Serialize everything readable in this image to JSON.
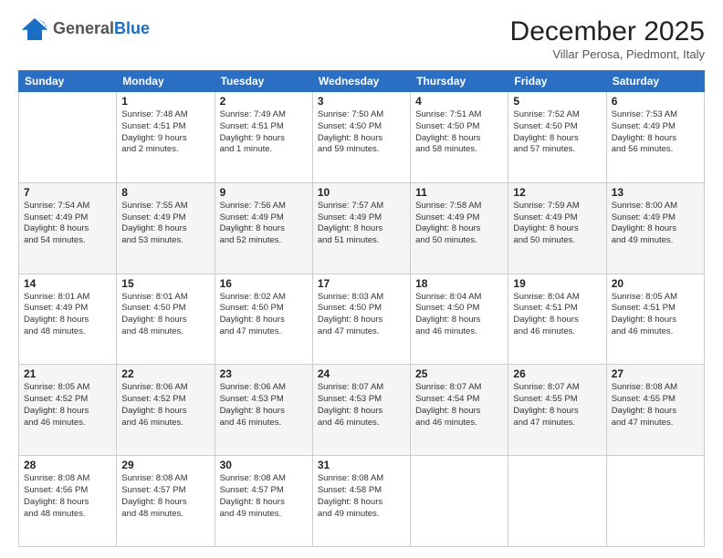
{
  "logo": {
    "general": "General",
    "blue": "Blue"
  },
  "header": {
    "month": "December 2025",
    "location": "Villar Perosa, Piedmont, Italy"
  },
  "days_of_week": [
    "Sunday",
    "Monday",
    "Tuesday",
    "Wednesday",
    "Thursday",
    "Friday",
    "Saturday"
  ],
  "weeks": [
    [
      {
        "day": "",
        "info": ""
      },
      {
        "day": "1",
        "info": "Sunrise: 7:48 AM\nSunset: 4:51 PM\nDaylight: 9 hours\nand 2 minutes."
      },
      {
        "day": "2",
        "info": "Sunrise: 7:49 AM\nSunset: 4:51 PM\nDaylight: 9 hours\nand 1 minute."
      },
      {
        "day": "3",
        "info": "Sunrise: 7:50 AM\nSunset: 4:50 PM\nDaylight: 8 hours\nand 59 minutes."
      },
      {
        "day": "4",
        "info": "Sunrise: 7:51 AM\nSunset: 4:50 PM\nDaylight: 8 hours\nand 58 minutes."
      },
      {
        "day": "5",
        "info": "Sunrise: 7:52 AM\nSunset: 4:50 PM\nDaylight: 8 hours\nand 57 minutes."
      },
      {
        "day": "6",
        "info": "Sunrise: 7:53 AM\nSunset: 4:49 PM\nDaylight: 8 hours\nand 56 minutes."
      }
    ],
    [
      {
        "day": "7",
        "info": "Sunrise: 7:54 AM\nSunset: 4:49 PM\nDaylight: 8 hours\nand 54 minutes."
      },
      {
        "day": "8",
        "info": "Sunrise: 7:55 AM\nSunset: 4:49 PM\nDaylight: 8 hours\nand 53 minutes."
      },
      {
        "day": "9",
        "info": "Sunrise: 7:56 AM\nSunset: 4:49 PM\nDaylight: 8 hours\nand 52 minutes."
      },
      {
        "day": "10",
        "info": "Sunrise: 7:57 AM\nSunset: 4:49 PM\nDaylight: 8 hours\nand 51 minutes."
      },
      {
        "day": "11",
        "info": "Sunrise: 7:58 AM\nSunset: 4:49 PM\nDaylight: 8 hours\nand 50 minutes."
      },
      {
        "day": "12",
        "info": "Sunrise: 7:59 AM\nSunset: 4:49 PM\nDaylight: 8 hours\nand 50 minutes."
      },
      {
        "day": "13",
        "info": "Sunrise: 8:00 AM\nSunset: 4:49 PM\nDaylight: 8 hours\nand 49 minutes."
      }
    ],
    [
      {
        "day": "14",
        "info": "Sunrise: 8:01 AM\nSunset: 4:49 PM\nDaylight: 8 hours\nand 48 minutes."
      },
      {
        "day": "15",
        "info": "Sunrise: 8:01 AM\nSunset: 4:50 PM\nDaylight: 8 hours\nand 48 minutes."
      },
      {
        "day": "16",
        "info": "Sunrise: 8:02 AM\nSunset: 4:50 PM\nDaylight: 8 hours\nand 47 minutes."
      },
      {
        "day": "17",
        "info": "Sunrise: 8:03 AM\nSunset: 4:50 PM\nDaylight: 8 hours\nand 47 minutes."
      },
      {
        "day": "18",
        "info": "Sunrise: 8:04 AM\nSunset: 4:50 PM\nDaylight: 8 hours\nand 46 minutes."
      },
      {
        "day": "19",
        "info": "Sunrise: 8:04 AM\nSunset: 4:51 PM\nDaylight: 8 hours\nand 46 minutes."
      },
      {
        "day": "20",
        "info": "Sunrise: 8:05 AM\nSunset: 4:51 PM\nDaylight: 8 hours\nand 46 minutes."
      }
    ],
    [
      {
        "day": "21",
        "info": "Sunrise: 8:05 AM\nSunset: 4:52 PM\nDaylight: 8 hours\nand 46 minutes."
      },
      {
        "day": "22",
        "info": "Sunrise: 8:06 AM\nSunset: 4:52 PM\nDaylight: 8 hours\nand 46 minutes."
      },
      {
        "day": "23",
        "info": "Sunrise: 8:06 AM\nSunset: 4:53 PM\nDaylight: 8 hours\nand 46 minutes."
      },
      {
        "day": "24",
        "info": "Sunrise: 8:07 AM\nSunset: 4:53 PM\nDaylight: 8 hours\nand 46 minutes."
      },
      {
        "day": "25",
        "info": "Sunrise: 8:07 AM\nSunset: 4:54 PM\nDaylight: 8 hours\nand 46 minutes."
      },
      {
        "day": "26",
        "info": "Sunrise: 8:07 AM\nSunset: 4:55 PM\nDaylight: 8 hours\nand 47 minutes."
      },
      {
        "day": "27",
        "info": "Sunrise: 8:08 AM\nSunset: 4:55 PM\nDaylight: 8 hours\nand 47 minutes."
      }
    ],
    [
      {
        "day": "28",
        "info": "Sunrise: 8:08 AM\nSunset: 4:56 PM\nDaylight: 8 hours\nand 48 minutes."
      },
      {
        "day": "29",
        "info": "Sunrise: 8:08 AM\nSunset: 4:57 PM\nDaylight: 8 hours\nand 48 minutes."
      },
      {
        "day": "30",
        "info": "Sunrise: 8:08 AM\nSunset: 4:57 PM\nDaylight: 8 hours\nand 49 minutes."
      },
      {
        "day": "31",
        "info": "Sunrise: 8:08 AM\nSunset: 4:58 PM\nDaylight: 8 hours\nand 49 minutes."
      },
      {
        "day": "",
        "info": ""
      },
      {
        "day": "",
        "info": ""
      },
      {
        "day": "",
        "info": ""
      }
    ]
  ]
}
